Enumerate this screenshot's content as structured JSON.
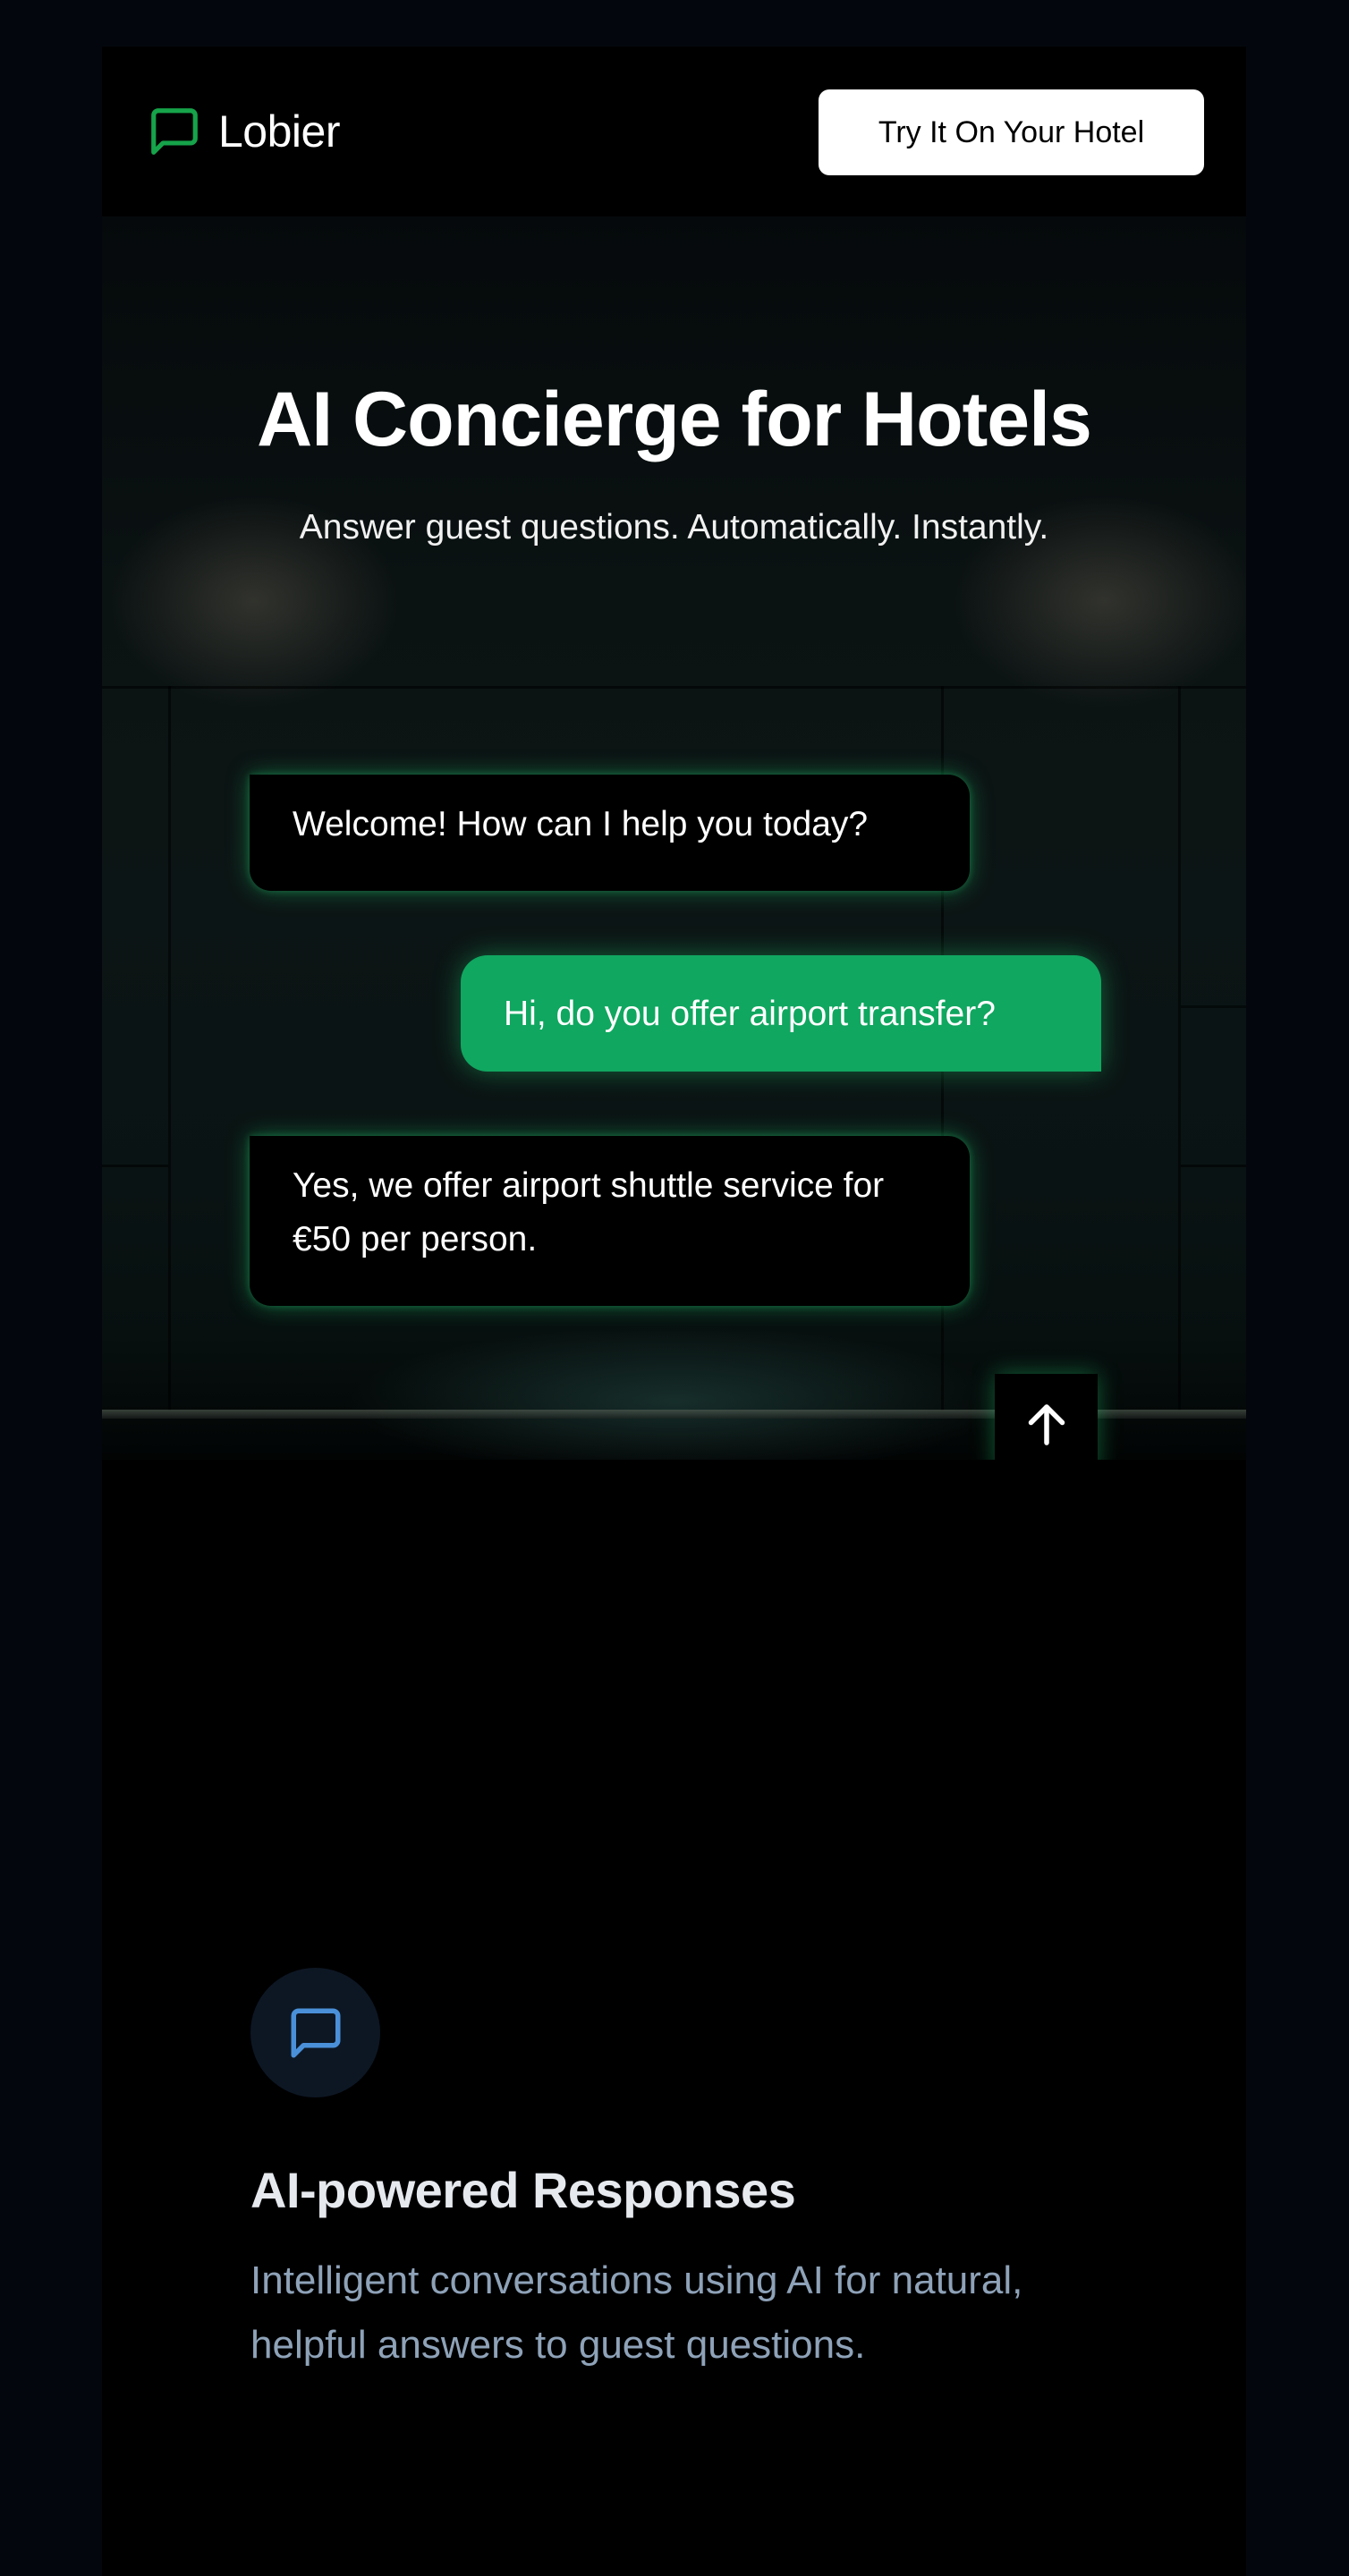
{
  "brand": {
    "name": "Lobier",
    "logo_icon": "chat-bubble-icon",
    "accent_color": "#16a34a"
  },
  "header": {
    "cta_label": "Try It On Your Hotel"
  },
  "hero": {
    "title": "AI Concierge for Hotels",
    "subtitle": "Answer guest questions. Automatically. Instantly.",
    "messages": [
      {
        "from": "bot",
        "text": "Welcome! How can I help you today?"
      },
      {
        "from": "user",
        "text": "Hi, do you offer airport transfer?"
      },
      {
        "from": "bot",
        "text": "Yes, we offer airport shuttle service for €50 per person."
      }
    ],
    "user_bubble_color": "#10a760",
    "scroll_top_icon": "arrow-up-icon"
  },
  "feature": {
    "icon": "message-square-icon",
    "icon_color": "#4a90d9",
    "title": "AI-powered Responses",
    "description": "Intelligent conversations using AI for natural, helpful answers to guest questions."
  }
}
